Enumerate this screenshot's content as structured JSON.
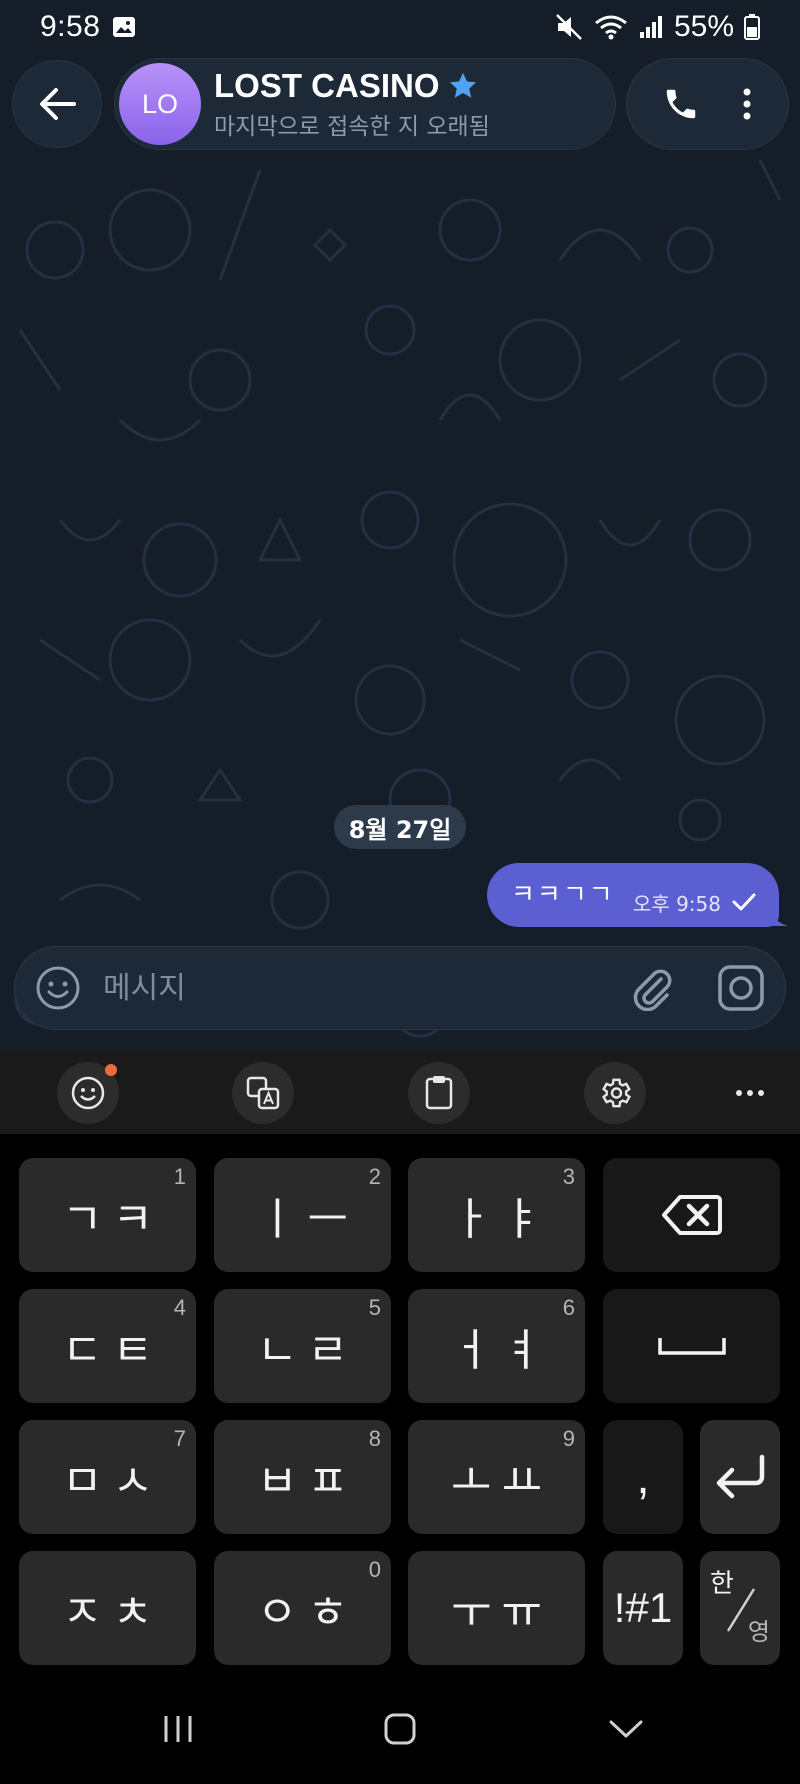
{
  "status_bar": {
    "time": "9:58",
    "battery": "55%",
    "icons": [
      "gallery-icon",
      "mute-icon",
      "wifi-icon",
      "signal-icon",
      "battery-icon"
    ]
  },
  "header": {
    "avatar_initials": "LO",
    "title": "LOST CASINO",
    "subtitle": "마지막으로 접속한 지 오래됨",
    "avatar_color": "#8a63ea"
  },
  "chat": {
    "date_chip": "8월 27일",
    "messages": [
      {
        "text": "ㅋㅋㄱㄱ",
        "time": "오후 9:58",
        "status": "sent",
        "outgoing": true
      }
    ],
    "bubble_color": "#5c5fd2"
  },
  "input": {
    "placeholder": "메시지"
  },
  "keyboard": {
    "rows": [
      [
        {
          "label": "ㄱㅋ",
          "num": "1"
        },
        {
          "label": "ㅣㅡ",
          "num": "2"
        },
        {
          "label": "ㅏㅑ",
          "num": "3"
        }
      ],
      [
        {
          "label": "ㄷㅌ",
          "num": "4"
        },
        {
          "label": "ㄴㄹ",
          "num": "5"
        },
        {
          "label": "ㅓㅕ",
          "num": "6"
        }
      ],
      [
        {
          "label": "ㅁㅅ",
          "num": "7"
        },
        {
          "label": "ㅂㅍ",
          "num": "8"
        },
        {
          "label": "ㅗㅛ",
          "num": "9"
        }
      ],
      [
        {
          "label": "ㅈㅊ",
          "num": ""
        },
        {
          "label": "ㅇㅎ",
          "num": "0"
        },
        {
          "label": "ㅜㅠ",
          "num": ""
        }
      ]
    ],
    "comma": ",",
    "symbols": "!#1",
    "lang_top": "한",
    "lang_bottom": "영"
  }
}
